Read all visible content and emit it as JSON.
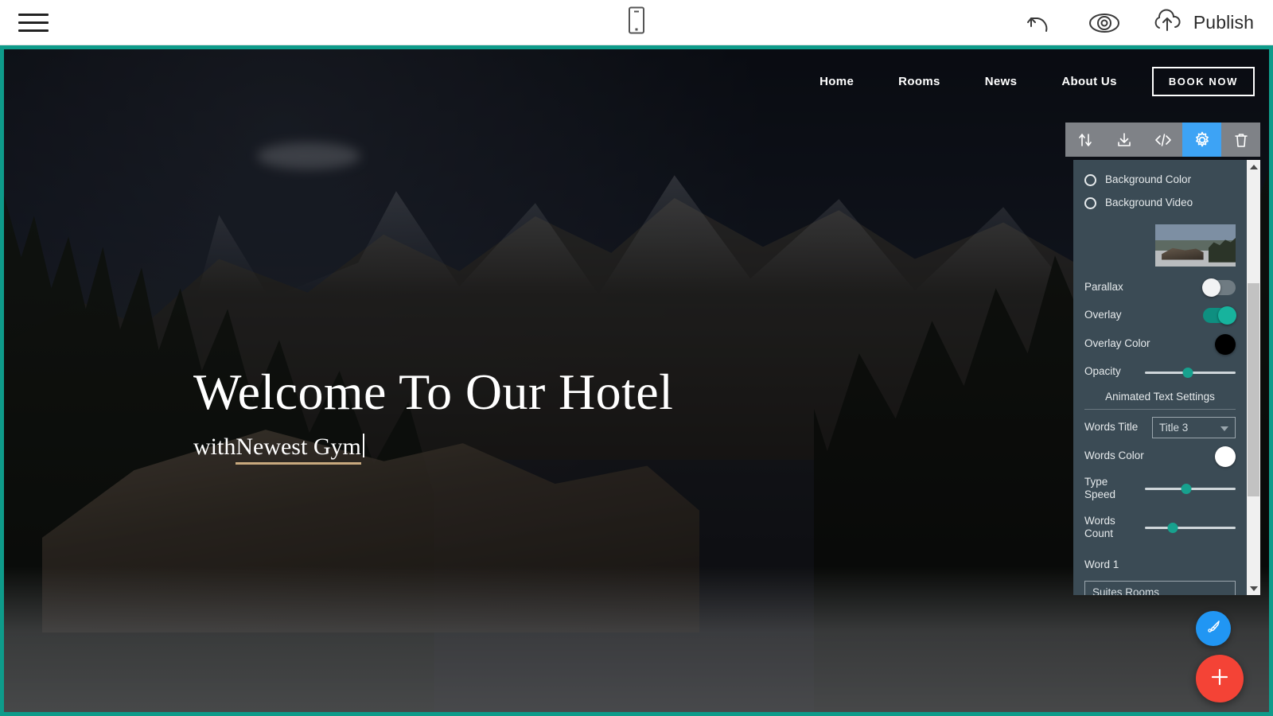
{
  "app_bar": {
    "menu_icon": "hamburger-menu-icon",
    "device_icon": "mobile-device-icon",
    "undo_icon": "undo-icon",
    "preview_icon": "eye-preview-icon",
    "publish_icon": "cloud-upload-icon",
    "publish_label": "Publish"
  },
  "site_nav": {
    "links": [
      {
        "label": "Home"
      },
      {
        "label": "Rooms"
      },
      {
        "label": "News"
      },
      {
        "label": "About Us"
      }
    ],
    "cta_label": "BOOK NOW"
  },
  "hero": {
    "title": "Welcome To Our Hotel",
    "subtitle_lead": "with ",
    "subtitle_word": "Newest Gym",
    "underline_color": "#c8a97e"
  },
  "block_toolbar": {
    "buttons": [
      {
        "name": "move-block-icon",
        "active": false
      },
      {
        "name": "download-block-icon",
        "active": false
      },
      {
        "name": "code-editor-icon",
        "active": false
      },
      {
        "name": "block-settings-gear-icon",
        "active": true
      },
      {
        "name": "delete-block-icon",
        "active": false
      }
    ],
    "active_color": "#3da3f5"
  },
  "settings_panel": {
    "background_color_option": "Background Color",
    "background_video_option": "Background Video",
    "image_thumb_name": "background-image-thumbnail",
    "parallax_label": "Parallax",
    "parallax_state": "off",
    "overlay_label": "Overlay",
    "overlay_state": "on",
    "overlay_color_label": "Overlay Color",
    "overlay_color_value": "#000000",
    "opacity_label": "Opacity",
    "opacity_percent": 47,
    "section_title": "Animated Text Settings",
    "words_title_label": "Words Title",
    "words_title_value": "Title 3",
    "words_color_label": "Words Color",
    "words_color_value": "#ffffff",
    "type_speed_label": "Type Speed",
    "type_speed_percent": 46,
    "words_count_label": "Words Count",
    "words_count_percent": 31,
    "word1_label": "Word 1",
    "word1_value": "Suites Rooms",
    "accent_color": "#17a18e",
    "panel_color": "#3b4b55"
  },
  "fabs": {
    "style_icon": "paintbrush-style-icon",
    "style_color": "#2196f3",
    "add_icon": "plus-add-block-icon",
    "add_color": "#f44336"
  }
}
